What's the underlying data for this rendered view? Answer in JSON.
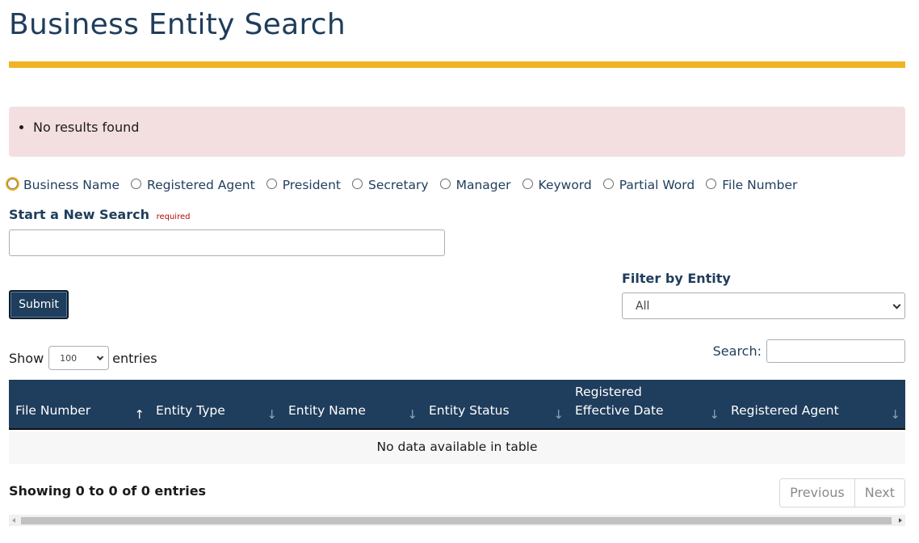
{
  "page": {
    "title": "Business Entity Search"
  },
  "alert": {
    "messages": [
      "No results found"
    ]
  },
  "search_type": {
    "options": [
      "Business Name",
      "Registered Agent",
      "President",
      "Secretary",
      "Manager",
      "Keyword",
      "Partial Word",
      "File Number"
    ],
    "selected": ""
  },
  "search": {
    "label": "Start a New Search",
    "required_text": "required",
    "value": "",
    "submit_label": "Submit"
  },
  "filter": {
    "label": "Filter by Entity",
    "selected": "All"
  },
  "table_controls": {
    "show_label": "Show",
    "page_length": "100",
    "entries_label": "entries",
    "search_label": "Search:",
    "search_value": ""
  },
  "table": {
    "columns": [
      {
        "line1": "File Number",
        "line2": "",
        "sort_arrow": "↑",
        "sorted": true
      },
      {
        "line1": "Entity Type",
        "line2": "",
        "sort_arrow": "↓",
        "sorted": false
      },
      {
        "line1": "Entity Name",
        "line2": "",
        "sort_arrow": "↓",
        "sorted": false
      },
      {
        "line1": "Entity Status",
        "line2": "",
        "sort_arrow": "↓",
        "sorted": false
      },
      {
        "line1": "Registered",
        "line2": "Effective Date",
        "sort_arrow": "↓",
        "sorted": false
      },
      {
        "line1": "Registered Agent",
        "line2": "",
        "sort_arrow": "↓",
        "sorted": false
      }
    ],
    "empty_message": "No data available in table"
  },
  "footer": {
    "info": "Showing 0 to 0 of 0 entries",
    "previous_label": "Previous",
    "next_label": "Next"
  },
  "colors": {
    "brand_navy": "#1f3d5c",
    "accent_gold": "#f0b323",
    "alert_bg": "#f4dfe0",
    "required_red": "#b50909"
  }
}
